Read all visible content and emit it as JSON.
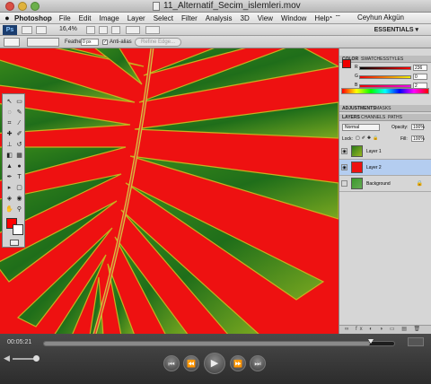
{
  "window": {
    "title": "11_Alternatif_Secim_islemleri.mov"
  },
  "menubar": {
    "app_name": "Photoshop",
    "items": [
      "File",
      "Edit",
      "Image",
      "Layer",
      "Select",
      "Filter",
      "Analysis",
      "3D",
      "View",
      "Window",
      "Help"
    ],
    "user": "Ceyhun Akgün"
  },
  "appbar": {
    "logo": "Ps",
    "zoom": "16,4%",
    "workspace": "ESSENTIALS ▾"
  },
  "options": {
    "feather_label": "Feather:",
    "feather_value": "0 px",
    "antialias_label": "Anti-alias",
    "antialias_checked": true,
    "refine_edge": "Refine Edge..."
  },
  "color_panel": {
    "tabs": [
      "COLOR",
      "SWATCHES",
      "STYLES"
    ],
    "channels": [
      {
        "label": "R",
        "value": "236"
      },
      {
        "label": "G",
        "value": "0"
      },
      {
        "label": "B",
        "value": "2"
      }
    ]
  },
  "adjustments_panel": {
    "tabs": [
      "ADJUSTMENTS",
      "MASKS"
    ]
  },
  "layers_panel": {
    "tabs": [
      "LAYERS",
      "CHANNELS",
      "PATHS"
    ],
    "blend_mode": "Normal",
    "opacity_label": "Opacity:",
    "opacity": "100%",
    "lock_label": "Lock:",
    "fill_label": "Fill:",
    "fill": "100%",
    "layers": [
      {
        "name": "Layer 1",
        "visible": true,
        "selected": false
      },
      {
        "name": "Layer 2",
        "visible": true,
        "selected": true
      },
      {
        "name": "Background",
        "visible": false,
        "selected": false,
        "locked": true
      }
    ]
  },
  "player": {
    "timecode": "00:05:21",
    "progress": 0.93
  },
  "colors": {
    "accent_red": "#ee1111",
    "leaf_green": "#1f7a1f",
    "selection_blue": "#b4cdf0"
  }
}
